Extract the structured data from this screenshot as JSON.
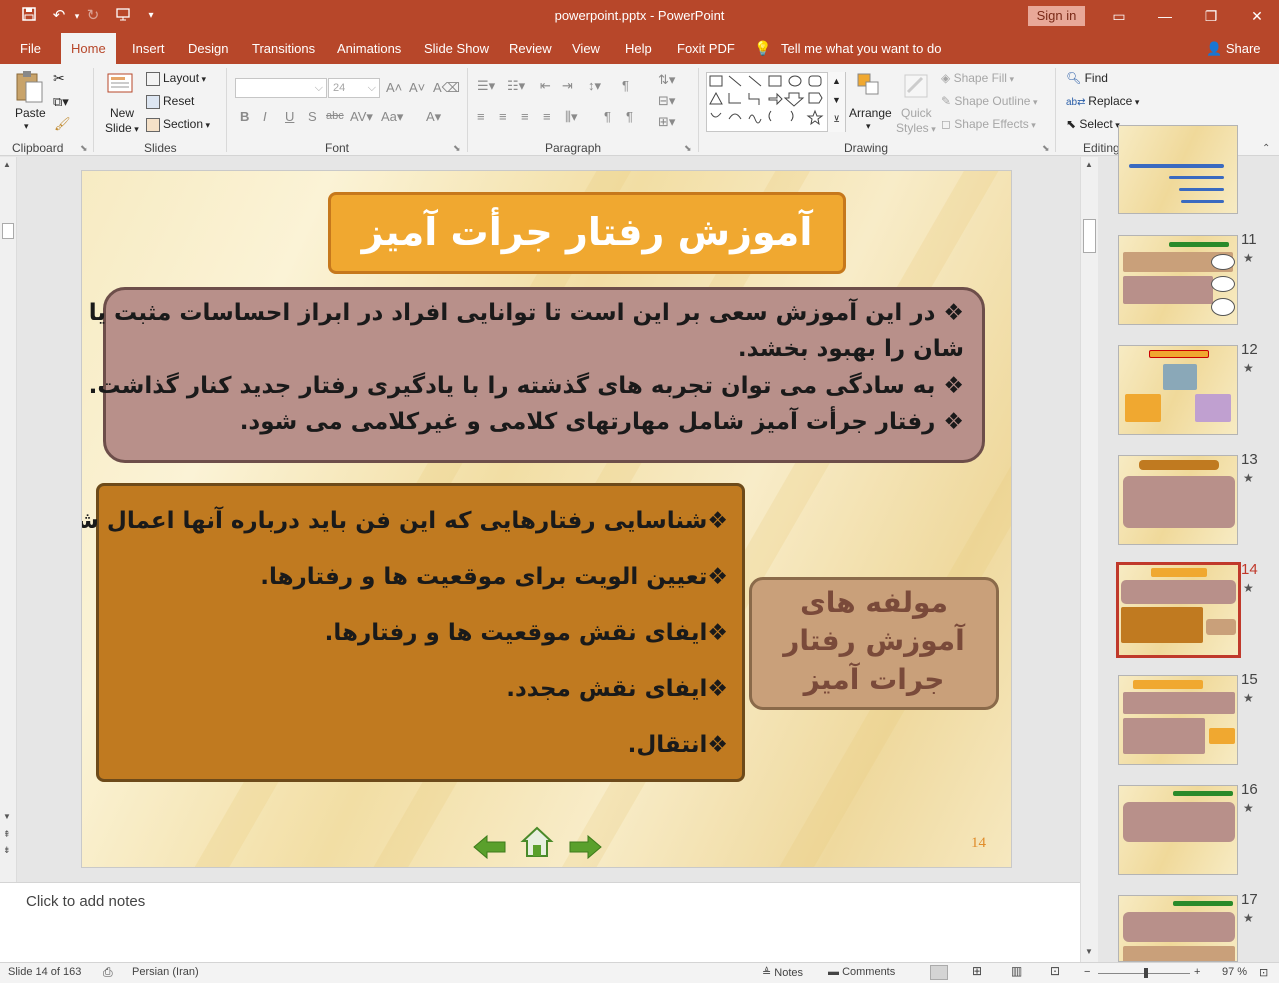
{
  "titlebar": {
    "document_title": "powerpoint.pptx  -  PowerPoint",
    "sign_in": "Sign in"
  },
  "tabs": [
    "File",
    "Home",
    "Insert",
    "Design",
    "Transitions",
    "Animations",
    "Slide Show",
    "Review",
    "View",
    "Help",
    "Foxit PDF"
  ],
  "active_tab": "Home",
  "tell_me": "Tell me what you want to do",
  "share": "Share",
  "ribbon": {
    "clipboard": {
      "label": "Clipboard",
      "paste": "Paste"
    },
    "slides": {
      "label": "Slides",
      "new_slide_1": "New",
      "new_slide_2": "Slide",
      "layout": "Layout",
      "reset": "Reset",
      "section": "Section"
    },
    "font": {
      "label": "Font",
      "size": "24",
      "bold": "B",
      "italic": "I",
      "underline": "U",
      "shadow": "S",
      "strike": "abc"
    },
    "paragraph": {
      "label": "Paragraph"
    },
    "drawing": {
      "label": "Drawing",
      "arrange": "Arrange",
      "quick_styles_1": "Quick",
      "quick_styles_2": "Styles",
      "shape_fill": "Shape Fill",
      "shape_outline": "Shape Outline",
      "shape_effects": "Shape Effects"
    },
    "editing": {
      "label": "Editing",
      "find": "Find",
      "replace": "Replace",
      "select": "Select"
    }
  },
  "slide": {
    "title": "آموزش رفتار جرأت آمیز",
    "intro_lines": [
      "❖ در این آموزش سعی بر این است تا توانایی افراد در ابراز احساسات مثبت یا منفی",
      "شان را بهبود بخشد.",
      "❖ به سادگی می توان تجربه های گذشته را با یادگیری رفتار جدید کنار گذاشت.",
      "❖ رفتار جرأت آمیز شامل مهارتهای کلامی و غیرکلامی می شود."
    ],
    "steps": [
      "❖شناسایی رفتارهایی که این فن باید درباره آنها اعمال شود.",
      "❖تعیین الویت برای موقعیت ها و رفتارها.",
      "❖ایفای نقش موقعیت ها و رفتارها.",
      "❖ایفای نقش مجدد.",
      "❖انتقال."
    ],
    "components_lines": [
      "مولفه های",
      "آموزش رفتار",
      "جرات آمیز"
    ],
    "number": "14"
  },
  "notes_placeholder": "Click to add notes",
  "thumbnails": [
    {
      "num": "",
      "star": ""
    },
    {
      "num": "11",
      "star": "★"
    },
    {
      "num": "12",
      "star": "★"
    },
    {
      "num": "13",
      "star": "★"
    },
    {
      "num": "14",
      "star": "★"
    },
    {
      "num": "15",
      "star": "★"
    },
    {
      "num": "16",
      "star": "★"
    },
    {
      "num": "17",
      "star": "★"
    }
  ],
  "status": {
    "slide_info": "Slide 14 of 163",
    "language": "Persian (Iran)",
    "notes": "Notes",
    "comments": "Comments",
    "zoom": "97 %"
  },
  "colors": {
    "accent": "#b7472a",
    "title_box": "#f0a830",
    "intro_box": "#b8908a",
    "steps_box": "#c07a20",
    "components_box": "#c9a07a",
    "selected_thumb_border": "#c0392b"
  }
}
